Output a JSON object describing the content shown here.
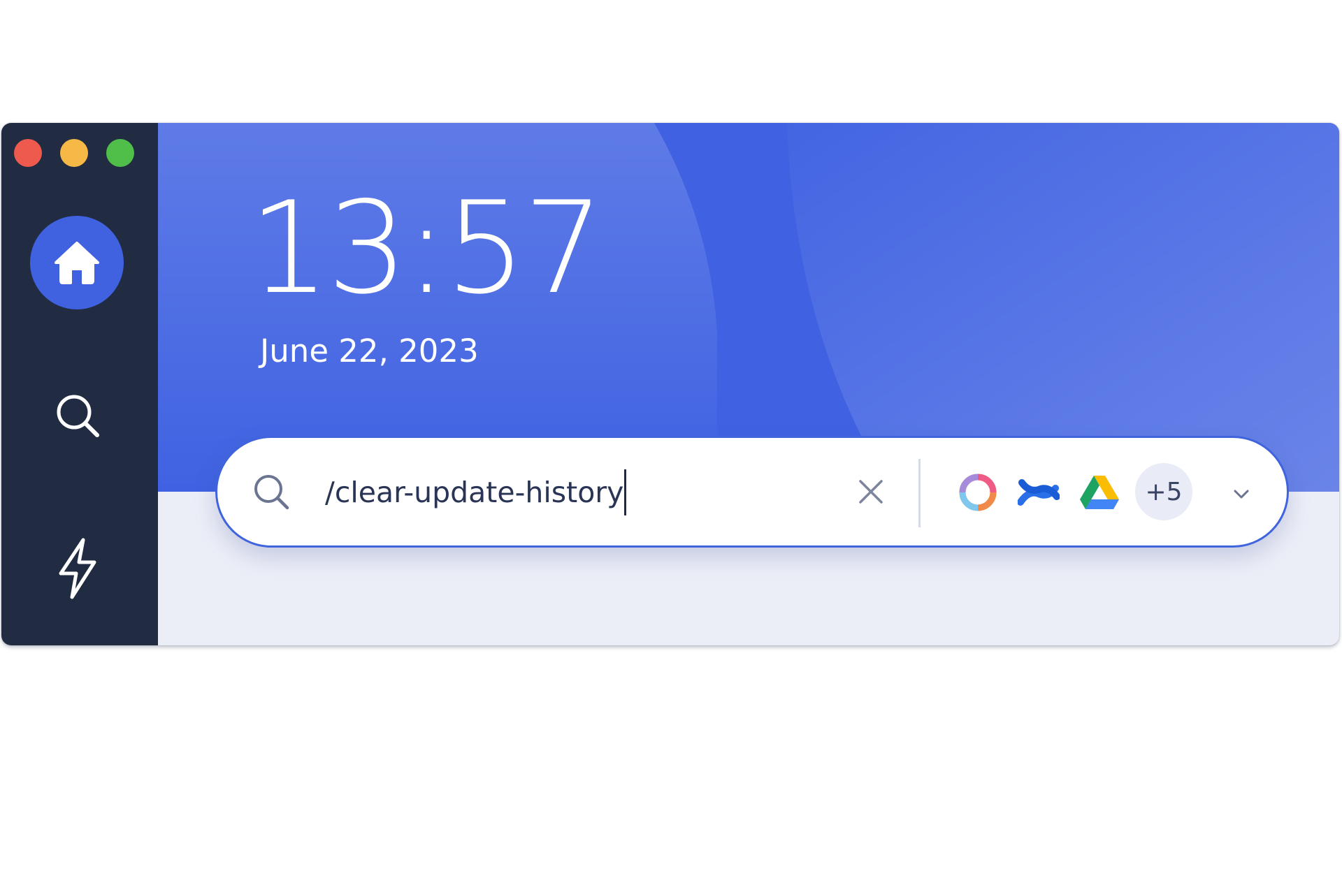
{
  "window": {
    "controls": [
      "close",
      "minimize",
      "maximize"
    ]
  },
  "sidebar": {
    "items": [
      {
        "id": "home",
        "icon": "home-icon",
        "active": true
      },
      {
        "id": "search",
        "icon": "search-icon",
        "active": false
      },
      {
        "id": "actions",
        "icon": "lightning-bolt-icon",
        "active": false
      }
    ]
  },
  "header": {
    "time": "13:57",
    "date": "June 22, 2023"
  },
  "search": {
    "value": "/clear-update-history",
    "icon": "search-icon",
    "clear_icon": "close-icon",
    "sources": [
      {
        "name": "colorful-ring-app-icon"
      },
      {
        "name": "confluence-icon"
      },
      {
        "name": "google-drive-icon"
      }
    ],
    "more_sources": "+5",
    "expand_icon": "chevron-down-icon"
  },
  "colors": {
    "sidebar": "#212b41",
    "accent": "#4062e2",
    "content_bg": "#eceef7"
  }
}
